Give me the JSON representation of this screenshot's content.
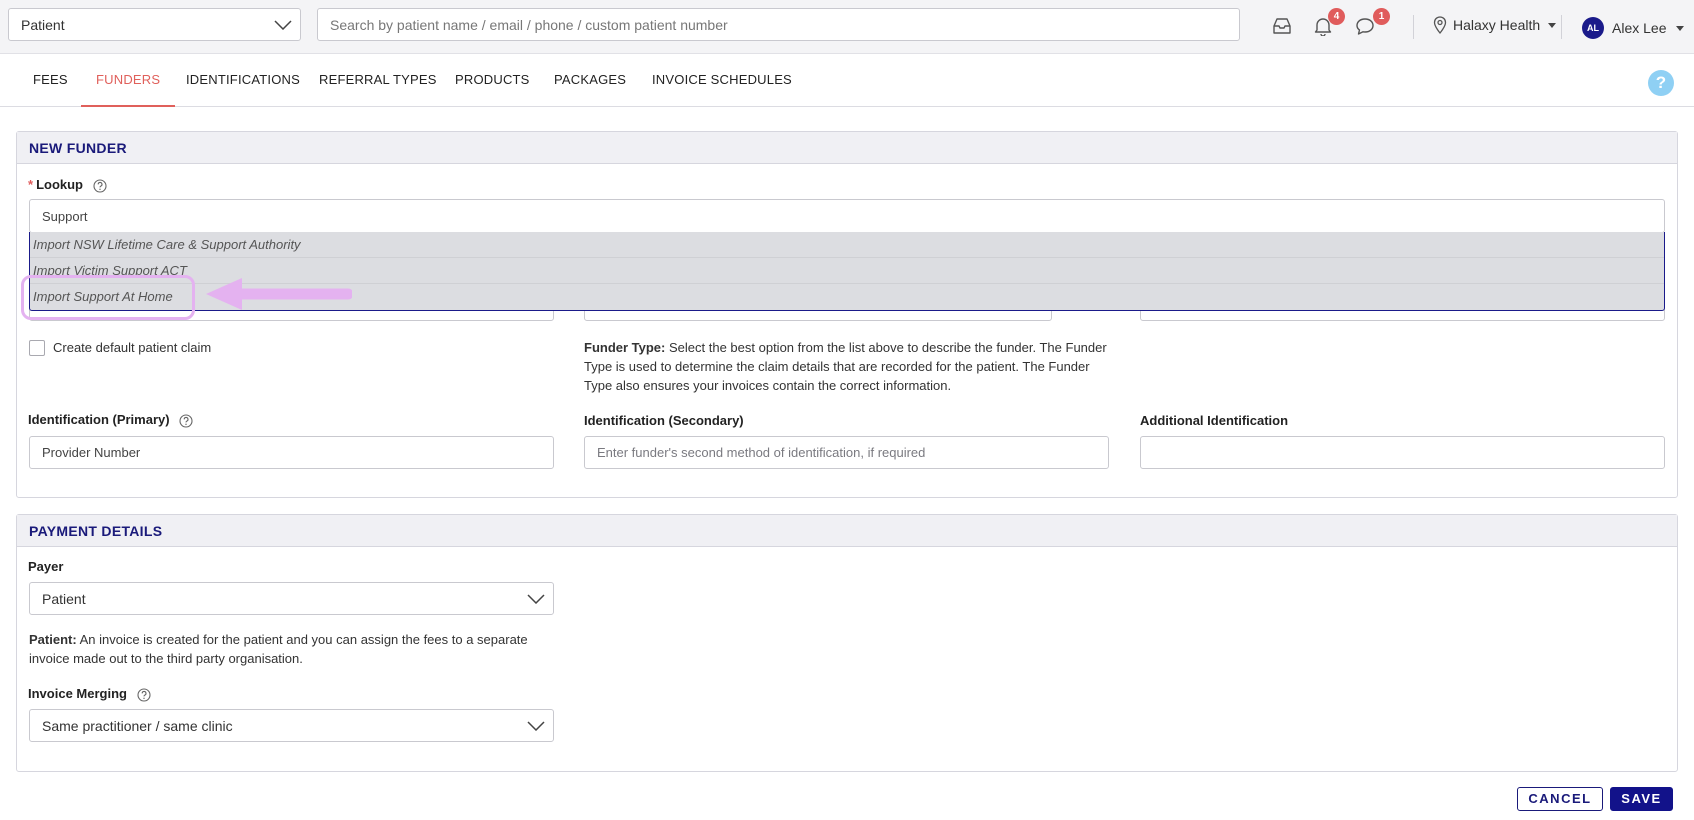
{
  "topbar": {
    "patient_select": "Patient",
    "search_placeholder": "Search by patient name / email / phone / custom patient number",
    "notifications_count": "4",
    "messages_count": "1",
    "location": "Halaxy Health",
    "user_initials": "AL",
    "user_name": "Alex Lee"
  },
  "tabs": [
    {
      "label": "FEES"
    },
    {
      "label": "FUNDERS"
    },
    {
      "label": "IDENTIFICATIONS"
    },
    {
      "label": "REFERRAL TYPES"
    },
    {
      "label": "PRODUCTS"
    },
    {
      "label": "PACKAGES"
    },
    {
      "label": "INVOICE SCHEDULES"
    }
  ],
  "help_label": "?",
  "new_funder": {
    "title": "NEW FUNDER",
    "required_mark": "*",
    "lookup_label": "Lookup",
    "lookup_value": "Support",
    "dropdown_items": [
      "Import NSW Lifetime Care & Support Authority",
      "Import Victim Support ACT",
      "Import Support At Home"
    ],
    "create_claim_label": "Create default patient claim",
    "funder_type_help_bold": "Funder Type:",
    "funder_type_help": "Select the best option from the list above to describe the funder. The Funder Type is used to determine the claim details that are recorded for the patient. The Funder Type also ensures your invoices contain the correct information.",
    "id_primary_label": "Identification (Primary)",
    "id_primary_value": "Provider Number",
    "id_secondary_label": "Identification (Secondary)",
    "id_secondary_placeholder": "Enter funder's second method of identification, if required",
    "id_additional_label": "Additional Identification",
    "id_additional_value": ""
  },
  "payment": {
    "title": "PAYMENT DETAILS",
    "payer_label": "Payer",
    "payer_value": "Patient",
    "payer_help_bold": "Patient:",
    "payer_help": "An invoice is created for the patient and you can assign the fees to a separate invoice made out to the third party organisation.",
    "merging_label": "Invoice Merging",
    "merging_value": "Same practitioner / same clinic"
  },
  "buttons": {
    "cancel": "CANCEL",
    "save": "SAVE"
  },
  "colors": {
    "accent": "#e0605b",
    "brand": "#12128a",
    "badge": "#e05c5c",
    "annotation": "#e4b2f0"
  }
}
